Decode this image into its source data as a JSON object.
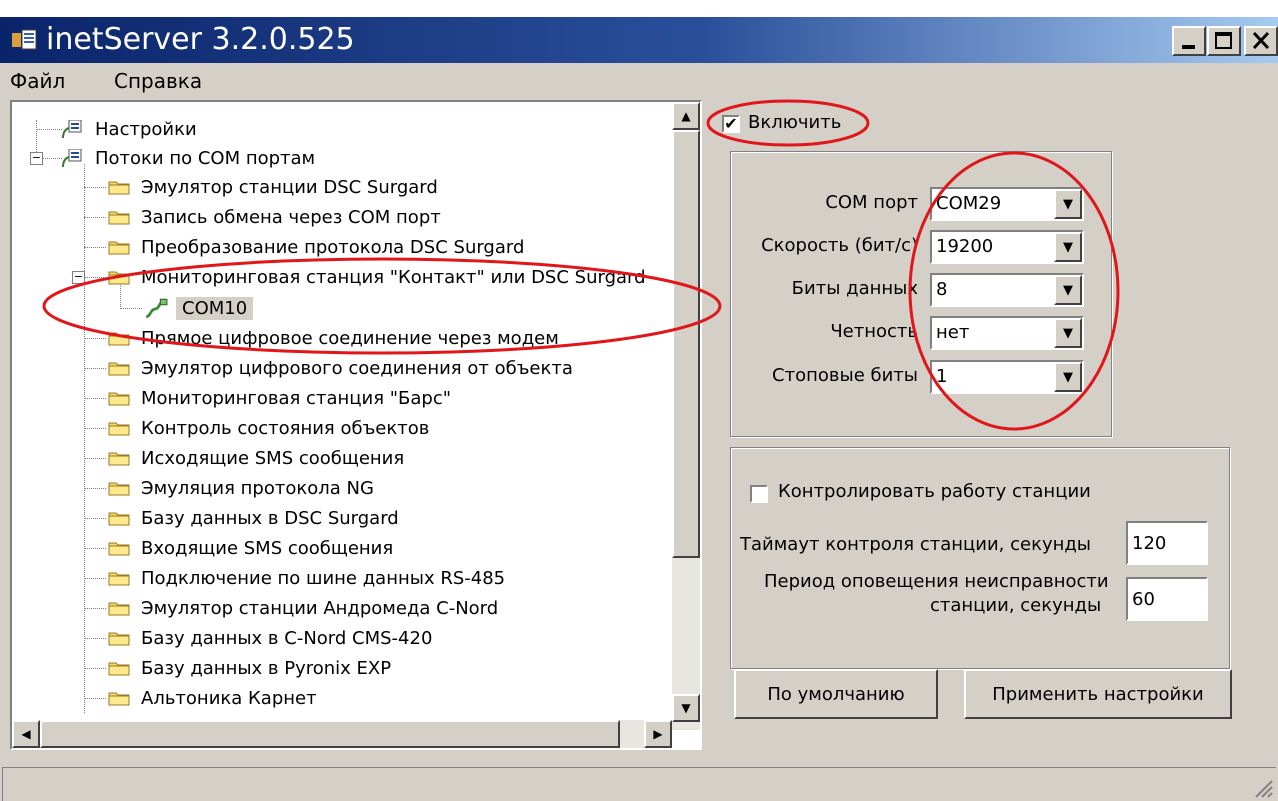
{
  "window": {
    "title": "inetServer 3.2.0.525"
  },
  "menu": [
    "Файл",
    "Справка"
  ],
  "tree": {
    "root_items": [
      {
        "label": "Настройки"
      },
      {
        "label": "Потоки по COM портам"
      }
    ],
    "children": [
      "Эмулятор станции DSC Surgard",
      "Запись обмена через COM порт",
      "Преобразование протокола DSC Surgard",
      "Мониторинговая станция \"Контакт\" или DSC Surgard",
      "Прямое цифровое соединение через модем",
      "Эмулятор цифрового соединения от объекта",
      "Мониторинговая станция \"Барс\"",
      "Контроль состояния объектов",
      "Исходящие SMS сообщения",
      "Эмуляция протокола NG",
      "Базу данных в DSC Surgard",
      "Входящие SMS сообщения",
      "Подключение по шине данных RS-485",
      "Эмулятор станции Андромеда C-Nord",
      "Базу данных в C-Nord CMS-420",
      "Базу данных в Pyronix EXP",
      "Альтоника Карнет"
    ],
    "selected_port": "COM10"
  },
  "settings": {
    "enable_label": "Включить",
    "enable_checked": true,
    "port_fields": [
      {
        "label": "COM порт",
        "value": "COM29"
      },
      {
        "label": "Скорость (бит/с)",
        "value": "19200"
      },
      {
        "label": "Биты данных",
        "value": "8"
      },
      {
        "label": "Четность",
        "value": "нет"
      },
      {
        "label": "Стоповые биты",
        "value": "1"
      }
    ],
    "monitor_label": "Контролировать работу станции",
    "monitor_checked": false,
    "timeout_label": "Таймаут контроля станции, секунды",
    "timeout_value": "120",
    "period_label_line1": "Период оповещения неисправности",
    "period_label_line2": "станции, секунды",
    "period_value": "60",
    "default_button": "По умолчанию",
    "apply_button": "Применить настройки"
  },
  "annotation_color": "#e0161b"
}
